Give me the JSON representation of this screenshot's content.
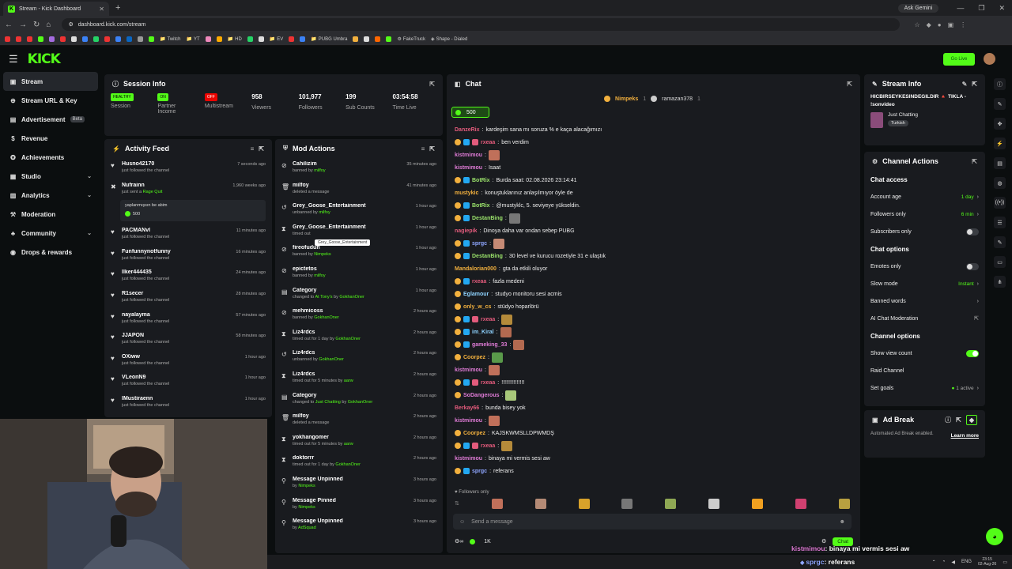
{
  "browser": {
    "tab_title": "Stream - Kick Dashboard",
    "url": "dashboard.kick.com/stream",
    "ask_gemini": "Ask Gemini",
    "bookmarks": [
      "Twitch",
      "YT",
      "HD",
      "EV",
      "PUBG Umbra",
      "FakeTruck",
      "Shape - Dialed"
    ]
  },
  "header": {
    "logo": "KICK",
    "golive_label": "Go Live"
  },
  "sidebar": {
    "items": [
      {
        "label": "Stream",
        "icon": "stream-icon",
        "active": true
      },
      {
        "label": "Stream URL & Key",
        "icon": "key-icon"
      },
      {
        "label": "Advertisement",
        "icon": "ad-icon",
        "badge": "Beta"
      },
      {
        "label": "Revenue",
        "icon": "revenue-icon"
      },
      {
        "label": "Achievements",
        "icon": "trophy-icon"
      },
      {
        "label": "Studio",
        "icon": "studio-icon",
        "chevron": true
      },
      {
        "label": "Analytics",
        "icon": "analytics-icon",
        "chevron": true
      },
      {
        "label": "Moderation",
        "icon": "moderation-icon"
      },
      {
        "label": "Community",
        "icon": "community-icon",
        "chevron": true
      },
      {
        "label": "Drops & rewards",
        "icon": "drops-icon"
      }
    ]
  },
  "session": {
    "title": "Session Info",
    "stats": [
      {
        "badge": "HEALTHY",
        "label": "Session",
        "color": "#53fc18"
      },
      {
        "badge": "ON",
        "label": "Partner Income",
        "color": "#53fc18"
      },
      {
        "badge": "OFF",
        "label": "Multistream",
        "color": "#eb0400"
      },
      {
        "value": "958",
        "label": "Viewers"
      },
      {
        "value": "101,977",
        "label": "Followers"
      },
      {
        "value": "199",
        "label": "Sub Counts"
      },
      {
        "value": "03:54:58",
        "label": "Time Live"
      }
    ]
  },
  "activity": {
    "title": "Activity Feed",
    "rows": [
      {
        "name": "Husno42170",
        "sub": "just followed the channel",
        "time": "7 seconds ago",
        "icon": "heart"
      },
      {
        "name": "Nufrainn",
        "sub": "just sent a",
        "extra": "Rage Quit",
        "time": "1,960 weeks ago",
        "icon": "raid",
        "box": "yaplanmışsın be abim",
        "box_amount": "500"
      },
      {
        "name": "PACMANvl",
        "sub": "just followed the channel",
        "time": "11 minutes ago",
        "icon": "heart"
      },
      {
        "name": "Funfunnynotfunny",
        "sub": "just followed the channel",
        "time": "16 minutes ago",
        "icon": "heart"
      },
      {
        "name": "Ilker444435",
        "sub": "just followed the channel",
        "time": "24 minutes ago",
        "icon": "heart"
      },
      {
        "name": "R1secer",
        "sub": "just followed the channel",
        "time": "28 minutes ago",
        "icon": "heart"
      },
      {
        "name": "nayalayma",
        "sub": "just followed the channel",
        "time": "57 minutes ago",
        "icon": "heart"
      },
      {
        "name": "JJAPON",
        "sub": "just followed the channel",
        "time": "58 minutes ago",
        "icon": "heart"
      },
      {
        "name": "OXiww",
        "sub": "just followed the channel",
        "time": "1 hour ago",
        "icon": "heart"
      },
      {
        "name": "VLeonN9",
        "sub": "just followed the channel",
        "time": "1 hour ago",
        "icon": "heart"
      },
      {
        "name": "IMustiraenn",
        "sub": "just followed the channel",
        "time": "1 hour ago",
        "icon": "heart"
      }
    ]
  },
  "mod": {
    "title": "Mod Actions",
    "tooltip": "Grey_Goose_Entertainment",
    "rows": [
      {
        "name": "Cahilizim",
        "sub": "banned by",
        "by": "milfoy",
        "time": "35 minutes ago",
        "icon": "ban"
      },
      {
        "name": "milfoy",
        "sub": "deleted a message",
        "by": "",
        "time": "41 minutes ago",
        "icon": "trash"
      },
      {
        "name": "Grey_Goose_Entertainment",
        "sub": "unbanned by",
        "by": "milfoy",
        "time": "1 hour ago",
        "icon": "unban"
      },
      {
        "name": "Grey_Goose_Entertainment",
        "sub": "timed out",
        "by": "",
        "time": "1 hour ago",
        "icon": "timeout"
      },
      {
        "name": "fireofudun",
        "sub": "banned by",
        "by": "Nimpeks",
        "time": "1 hour ago",
        "icon": "ban"
      },
      {
        "name": "epictetos",
        "sub": "banned by",
        "by": "milfoy",
        "time": "1 hour ago",
        "icon": "ban"
      },
      {
        "name": "Category",
        "sub": "changed to",
        "by": "At Tony's",
        "by2": "GokhanOner",
        "time": "1 hour ago",
        "icon": "category"
      },
      {
        "name": "mehmicoss",
        "sub": "banned by",
        "by": "GokhanOner",
        "time": "2 hours ago",
        "icon": "ban"
      },
      {
        "name": "Liz4rdcs",
        "sub": "timed out for 1 day by",
        "by": "GokhanOner",
        "time": "2 hours ago",
        "icon": "timeout"
      },
      {
        "name": "Liz4rdcs",
        "sub": "unbanned by",
        "by": "GokhanOner",
        "time": "2 hours ago",
        "icon": "unban"
      },
      {
        "name": "Liz4rdcs",
        "sub": "timed out for 5 minutes by",
        "by": "aarw",
        "time": "2 hours ago",
        "icon": "timeout"
      },
      {
        "name": "Category",
        "sub": "changed to",
        "by": "Just Chatting",
        "by2": "GokhanOner",
        "time": "2 hours ago",
        "icon": "category"
      },
      {
        "name": "milfoy",
        "sub": "deleted a message",
        "by": "",
        "time": "2 hours ago",
        "icon": "trash"
      },
      {
        "name": "yokhangomer",
        "sub": "timed out for 5 minutes by",
        "by": "aarw",
        "time": "2 hours ago",
        "icon": "timeout"
      },
      {
        "name": "doktorrr",
        "sub": "timed out for 1 day by",
        "by": "GokhanOner",
        "time": "2 hours ago",
        "icon": "timeout"
      },
      {
        "name": "Message Unpinned",
        "sub": "by",
        "by": "Nimpeks",
        "time": "3 hours ago",
        "icon": "pin"
      },
      {
        "name": "Message Pinned",
        "sub": "by",
        "by": "Nimpeks",
        "time": "3 hours ago",
        "icon": "pin"
      },
      {
        "name": "Message Unpinned",
        "sub": "by",
        "by": "AdSquad",
        "time": "3 hours ago",
        "icon": "pin"
      }
    ]
  },
  "chat": {
    "title": "Chat",
    "pinned_users": [
      "Nimpeks",
      "ramazan378"
    ],
    "pinned_counts": [
      "1",
      "1"
    ],
    "pill_amount": "500",
    "messages": [
      {
        "user": "DanzeRix",
        "color": "#e35b7c",
        "text": "kardeşim sana mı soruza % e kaça alacağımızı",
        "badges": 0
      },
      {
        "user": "rxeaa",
        "color": "#e35b7c",
        "text": "ben verdim",
        "badges": 3
      },
      {
        "user": "kistmimou",
        "color": "#e07cd7",
        "text": "",
        "badges": 0,
        "emote": "#c0705a"
      },
      {
        "user": "kistmimou",
        "color": "#e07cd7",
        "text": "Isaat",
        "badges": 0
      },
      {
        "user": "BotRix",
        "color": "#9be36b",
        "text": "Burda saat: 02.08.2026 23:14:41",
        "badges": 2
      },
      {
        "user": "mustykic",
        "color": "#f2b03e",
        "text": "konuştuklarınız anlaşılmıyor öyle de",
        "badges": 0
      },
      {
        "user": "BotRix",
        "color": "#9be36b",
        "text": "@mustyklc, 5. seviyeye yükseldin.",
        "badges": 2
      },
      {
        "user": "DestanBing",
        "color": "#9be36b",
        "text": "",
        "badges": 2,
        "emote": "#777"
      },
      {
        "user": "nagiepik",
        "color": "#e35b7c",
        "text": "Dinoya daha var ondan sebep PUBG",
        "badges": 0
      },
      {
        "user": "sprgc",
        "color": "#8fa6ff",
        "text": "",
        "badges": 2,
        "emote": "#c58a75"
      },
      {
        "user": "DestanBing",
        "color": "#9be36b",
        "text": "30 level ve kurucu rozetiyle 31 e ulaştık",
        "badges": 2
      },
      {
        "user": "Mandalorian000",
        "color": "#f2b03e",
        "text": "gta da etkili oluyor",
        "badges": 0
      },
      {
        "user": "rxeaa",
        "color": "#e35b7c",
        "text": "fazla medeni",
        "badges": 2
      },
      {
        "user": "Eglamour",
        "color": "#8fd3ff",
        "text": "studyo monitoru sesi acmis",
        "badges": 1
      },
      {
        "user": "only_w_cs",
        "color": "#f2b03e",
        "text": "stüdyo hoparlörü",
        "badges": 1
      },
      {
        "user": "rxeaa",
        "color": "#e35b7c",
        "text": "",
        "badges": 3,
        "emote": "#b48a3a"
      },
      {
        "user": "im_Kiral",
        "color": "#8fd3ff",
        "text": "",
        "badges": 2,
        "emote": "#b36a50"
      },
      {
        "user": "gameking_33",
        "color": "#e07cd7",
        "text": "",
        "badges": 2,
        "emote": "#b36a50"
      },
      {
        "user": "Coorpez",
        "color": "#f2b03e",
        "text": "",
        "badges": 1,
        "emote": "#5a9a4a"
      },
      {
        "user": "kistmimou",
        "color": "#e07cd7",
        "text": "",
        "badges": 0,
        "emote": "#c0705a"
      },
      {
        "user": "rxeaa",
        "color": "#e35b7c",
        "text": "!!!!!!!!!!!!!!!",
        "badges": 3
      },
      {
        "user": "SoDangerous",
        "color": "#e07cd7",
        "text": "",
        "badges": 1,
        "emote": "#a8c87a"
      },
      {
        "user": "Berkay66",
        "color": "#e35b7c",
        "text": "bunda bisey yok",
        "badges": 0
      },
      {
        "user": "kistmimou",
        "color": "#e07cd7",
        "text": "",
        "badges": 0,
        "emote": "#c0705a"
      },
      {
        "user": "Coorpez",
        "color": "#f2b03e",
        "text": "KAJSKWMSLLDPWMDŞ",
        "badges": 1
      },
      {
        "user": "rxeaa",
        "color": "#e35b7c",
        "text": "",
        "badges": 3,
        "emote": "#b48a3a"
      },
      {
        "user": "kistmimou",
        "color": "#e07cd7",
        "text": "binaya mi vermis sesi aw",
        "badges": 0
      },
      {
        "user": "sprgc",
        "color": "#8fa6ff",
        "text": "referans",
        "badges": 2
      }
    ],
    "followers_only": "Followers only",
    "placeholder": "Send a message",
    "viewers": "1K",
    "chat_button": "Chat"
  },
  "stream_info": {
    "title": "Stream Info",
    "stream_title": "HICBIRSEYKESINDEGILDIR 🔺 TIKLA - !sonvideo",
    "category": "Just Chatting",
    "language": "Turkish"
  },
  "channel_actions": {
    "title": "Channel Actions",
    "chat_access": "Chat access",
    "account_age": "Account age",
    "account_age_val": "1 day",
    "followers_only": "Followers only",
    "followers_only_val": "6 min",
    "subscribers_only": "Subscribers only",
    "chat_options": "Chat options",
    "emotes_only": "Emotes only",
    "slow_mode": "Slow mode",
    "slow_mode_val": "Instant",
    "banned_words": "Banned words",
    "ai_mod": "AI Chat Moderation",
    "channel_options": "Channel options",
    "show_view_count": "Show view count",
    "raid_channel": "Raid Channel",
    "set_goals": "Set goals",
    "set_goals_val": "1 active"
  },
  "ad_break": {
    "title": "Ad Break",
    "text": "Automated Ad Break enabled.",
    "learn_more": "Learn more"
  },
  "overlay": {
    "line1_user": "kistmimou",
    "line1_text": ": binaya mi vermis sesi aw",
    "line2_user": "sprgc",
    "line2_text": ": referans"
  },
  "taskbar": {
    "lang": "ENG",
    "time": "23:15",
    "date": "02-Aug-26"
  }
}
